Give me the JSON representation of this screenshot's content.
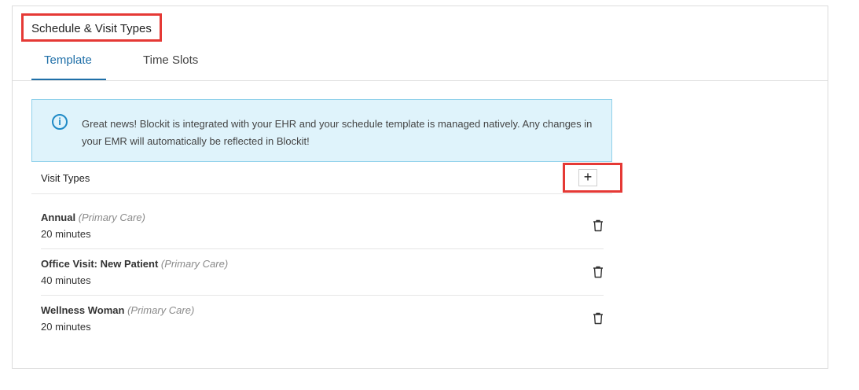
{
  "header": {
    "title": "Schedule & Visit Types"
  },
  "tabs": [
    {
      "label": "Template",
      "active": true
    },
    {
      "label": "Time Slots",
      "active": false
    }
  ],
  "info_banner": {
    "icon": "info-icon",
    "line1": "Great news! Blockit is integrated with your EHR and your schedule template is managed natively. Any changes in",
    "line2": "your EMR will automatically be reflected in Blockit!"
  },
  "visit_types": {
    "header": "Visit Types",
    "add_label": "+",
    "items": [
      {
        "name": "Annual",
        "category": "(Primary Care)",
        "duration": "20 minutes"
      },
      {
        "name": "Office Visit: New Patient",
        "category": "(Primary Care)",
        "duration": "40 minutes"
      },
      {
        "name": "Wellness Woman",
        "category": "(Primary Care)",
        "duration": "20 minutes"
      }
    ]
  },
  "colors": {
    "accent": "#1f6fa8",
    "highlight": "#e53935",
    "info_bg": "#dff3fb"
  }
}
